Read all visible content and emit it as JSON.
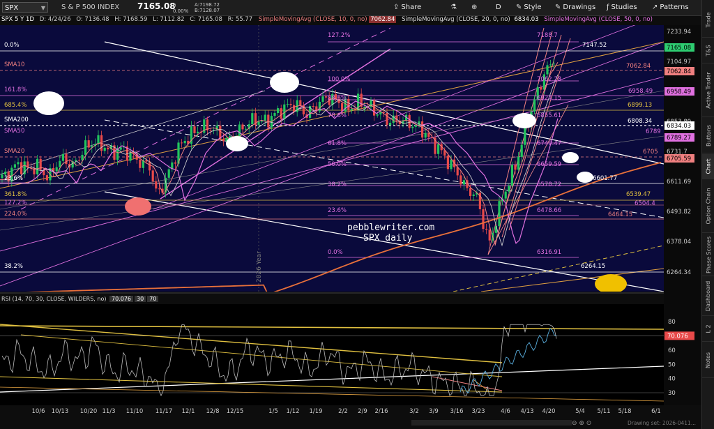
{
  "toolbar": {
    "symbol": "SPX",
    "instrument_name": "S & P 500 INDEX",
    "last_price": "7165.08",
    "change": "0",
    "change_pct": "0.00%",
    "bid": "A:7198.72",
    "ask": "B:7128.07",
    "share_label": "Share",
    "timeframe_label": "D",
    "style_label": "Style",
    "drawings_label": "Drawings",
    "studies_label": "Studies",
    "patterns_label": "Patterns"
  },
  "info_bar": {
    "chart_id": "SPX 5 Y 1D",
    "date": "D: 4/24/26",
    "open": "O: 7136.48",
    "high": "H: 7168.59",
    "low": "L: 7112.82",
    "close": "C: 7165.08",
    "range": "R: 55.77",
    "sma10_label": "SimpleMovingAvg (CLOSE, 10, 0, no)",
    "sma10_value": "7062.84",
    "sma20_label": "SimpleMovingAvg (CLOSE, 20, 0, no)",
    "sma20_value": "6834.03",
    "sma50_label": "SimpleMovingAvg (CLOSE, 50, 0, no)"
  },
  "sidebar": {
    "tabs": [
      "Trade",
      "T&S",
      "Active Trader",
      "Buttons",
      "Chart",
      "Option Chain",
      "Phase Scores",
      "Dashboard",
      "L 2",
      "Notes"
    ],
    "active": "Chart"
  },
  "chart_data": {
    "type": "candlestick",
    "symbol": "SPX",
    "timeframe": "1D",
    "watermark": "pebblewriter.com\nSPX daily",
    "year_marker": "2026 Year",
    "x_tick_labels": [
      "10/6",
      "10/13",
      "10/20",
      "11/3",
      "11/10",
      "11/17",
      "12/1",
      "12/8",
      "12/15",
      "1/5",
      "1/12",
      "1/19",
      "2/2",
      "2/9",
      "2/16",
      "3/2",
      "3/9",
      "3/16",
      "3/23",
      "4/6",
      "4/13",
      "4/20",
      "5/4",
      "5/11",
      "5/18",
      "6/1"
    ],
    "y_tick_labels": [
      "7233.94",
      "7104.97",
      "6978.31",
      "6853.89",
      "6731.7",
      "6611.69",
      "6493.82",
      "6378.04",
      "6264.34"
    ],
    "price_flags": [
      {
        "label": "7165.08",
        "color": "#2ecc71"
      },
      {
        "label": "7062.84",
        "color": "#f08080"
      },
      {
        "label": "6958.49",
        "color": "#e070e0"
      },
      {
        "label": "6834.03",
        "color": "#ffffff"
      },
      {
        "label": "6789.27",
        "color": "#e070e0"
      },
      {
        "label": "6705.59",
        "color": "#f08080"
      }
    ],
    "left_labels": [
      "0.0%",
      "SMA10",
      "161.8%",
      "685.4%",
      "SMA200",
      "SMA50",
      "SMA20",
      "23.6%",
      "361.8%",
      "127.2%",
      "224.0%",
      "38.2%"
    ],
    "fib_labels": [
      {
        "pct": "127.2%",
        "value": "7188.7"
      },
      {
        "pct": "100.0%",
        "value": "7062.28"
      },
      {
        "pct": "88.6%",
        "value": "6924.15"
      },
      {
        "pct": "78.6%",
        "value": "6855.61"
      },
      {
        "pct": "61.8%",
        "value": "6740.47"
      },
      {
        "pct": "50.0%",
        "value": "6659.59"
      },
      {
        "pct": "38.2%",
        "value": "6578.72"
      },
      {
        "pct": "23.6%",
        "value": "6478.66"
      },
      {
        "pct": "0.0%",
        "value": "6316.91"
      }
    ],
    "level_labels": [
      "7147.52",
      "7062.84",
      "6958.49",
      "6899.13",
      "6808.34",
      "6789",
      "6705",
      "6601.77",
      "6539.47",
      "6504.4",
      "6464.15",
      "6264.15"
    ],
    "rsi": {
      "header": "RSI (14, 70, 30, CLOSE, WILDERS, no)",
      "value": "70.076",
      "overbought": "30",
      "oversold": "70",
      "y_tick_labels": [
        "80",
        "70",
        "60",
        "50",
        "40",
        "30"
      ],
      "value_flag": "70.076"
    },
    "footer": "Drawing set: 2026-0411..."
  }
}
